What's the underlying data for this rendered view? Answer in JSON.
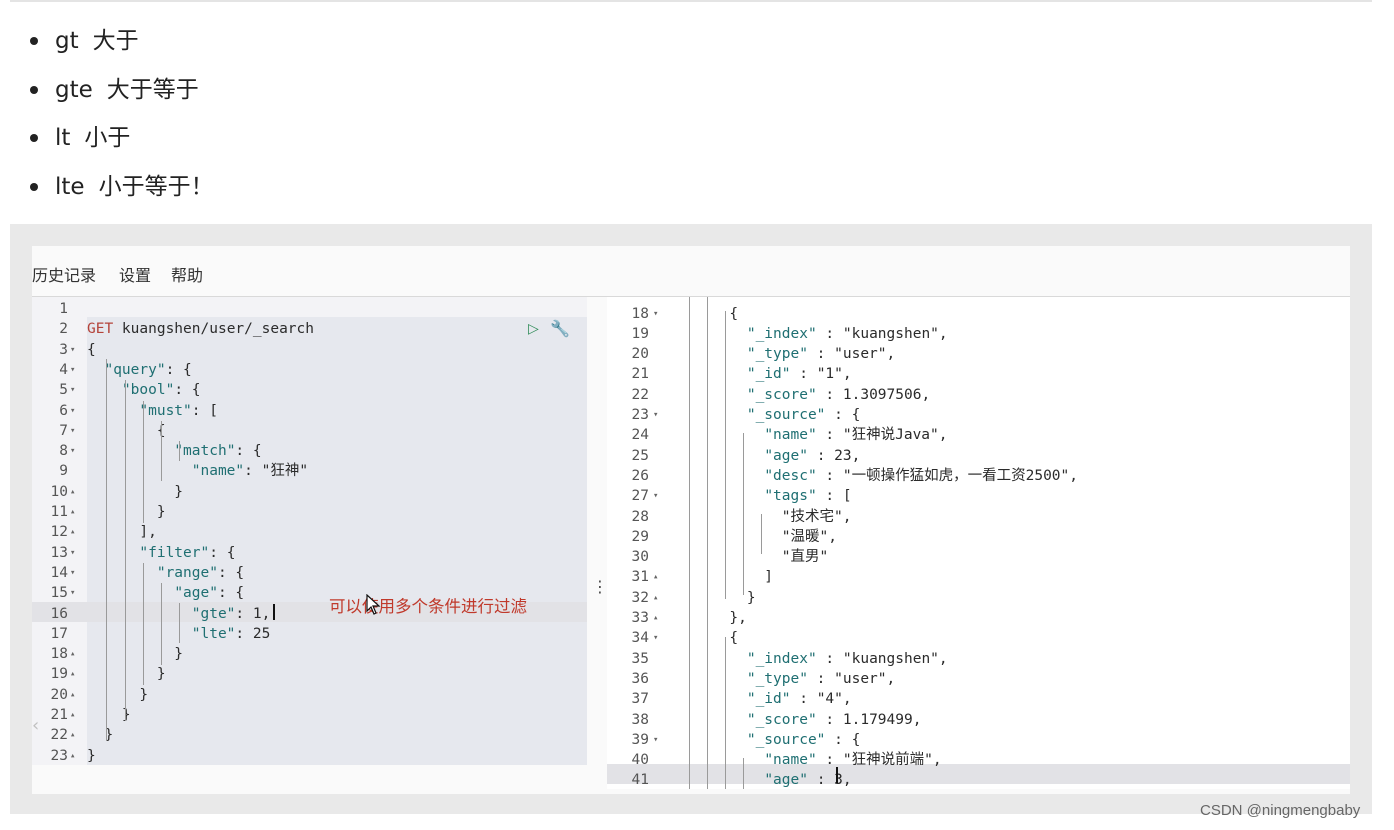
{
  "bullets": [
    {
      "op": "gt",
      "desc": "大于"
    },
    {
      "op": "gte",
      "desc": "大于等于"
    },
    {
      "op": "lt",
      "desc": "小于"
    },
    {
      "op": "lte",
      "desc": "小于等于！"
    }
  ],
  "menu": {
    "history": "历史记录",
    "settings": "设置",
    "help": "帮助"
  },
  "request_lines": [
    {
      "n": "1",
      "f": "",
      "t": ""
    },
    {
      "n": "2",
      "f": "",
      "t": "GET kuangshen/user/_search"
    },
    {
      "n": "3",
      "f": "▾",
      "t": "{"
    },
    {
      "n": "4",
      "f": "▾",
      "t": "  \"query\": {"
    },
    {
      "n": "5",
      "f": "▾",
      "t": "    \"bool\": {"
    },
    {
      "n": "6",
      "f": "▾",
      "t": "      \"must\": ["
    },
    {
      "n": "7",
      "f": "▾",
      "t": "        {"
    },
    {
      "n": "8",
      "f": "▾",
      "t": "          \"match\": {"
    },
    {
      "n": "9",
      "f": "",
      "t": "            \"name\": \"狂神\""
    },
    {
      "n": "10",
      "f": "▴",
      "t": "          }"
    },
    {
      "n": "11",
      "f": "▴",
      "t": "        }"
    },
    {
      "n": "12",
      "f": "▴",
      "t": "      ],"
    },
    {
      "n": "13",
      "f": "▾",
      "t": "      \"filter\": {"
    },
    {
      "n": "14",
      "f": "▾",
      "t": "        \"range\": {"
    },
    {
      "n": "15",
      "f": "▾",
      "t": "          \"age\": {"
    },
    {
      "n": "16",
      "f": "",
      "t": "            \"gte\": 1,"
    },
    {
      "n": "17",
      "f": "",
      "t": "            \"lte\": 25"
    },
    {
      "n": "18",
      "f": "▴",
      "t": "          }"
    },
    {
      "n": "19",
      "f": "▴",
      "t": "        }"
    },
    {
      "n": "20",
      "f": "▴",
      "t": "      }"
    },
    {
      "n": "21",
      "f": "▴",
      "t": "    }"
    },
    {
      "n": "22",
      "f": "▴",
      "t": "  }"
    },
    {
      "n": "23",
      "f": "▴",
      "t": "}"
    }
  ],
  "response_lines": [
    {
      "n": "18",
      "f": "▾",
      "t": "      {"
    },
    {
      "n": "19",
      "f": "",
      "t": "        \"_index\" : \"kuangshen\","
    },
    {
      "n": "20",
      "f": "",
      "t": "        \"_type\" : \"user\","
    },
    {
      "n": "21",
      "f": "",
      "t": "        \"_id\" : \"1\","
    },
    {
      "n": "22",
      "f": "",
      "t": "        \"_score\" : 1.3097506,"
    },
    {
      "n": "23",
      "f": "▾",
      "t": "        \"_source\" : {"
    },
    {
      "n": "24",
      "f": "",
      "t": "          \"name\" : \"狂神说Java\","
    },
    {
      "n": "25",
      "f": "",
      "t": "          \"age\" : 23,"
    },
    {
      "n": "26",
      "f": "",
      "t": "          \"desc\" : \"一顿操作猛如虎，一看工资2500\","
    },
    {
      "n": "27",
      "f": "▾",
      "t": "          \"tags\" : ["
    },
    {
      "n": "28",
      "f": "",
      "t": "            \"技术宅\","
    },
    {
      "n": "29",
      "f": "",
      "t": "            \"温暖\","
    },
    {
      "n": "30",
      "f": "",
      "t": "            \"直男\""
    },
    {
      "n": "31",
      "f": "▴",
      "t": "          ]"
    },
    {
      "n": "32",
      "f": "▴",
      "t": "        }"
    },
    {
      "n": "33",
      "f": "▴",
      "t": "      },"
    },
    {
      "n": "34",
      "f": "▾",
      "t": "      {"
    },
    {
      "n": "35",
      "f": "",
      "t": "        \"_index\" : \"kuangshen\","
    },
    {
      "n": "36",
      "f": "",
      "t": "        \"_type\" : \"user\","
    },
    {
      "n": "37",
      "f": "",
      "t": "        \"_id\" : \"4\","
    },
    {
      "n": "38",
      "f": "",
      "t": "        \"_score\" : 1.179499,"
    },
    {
      "n": "39",
      "f": "▾",
      "t": "        \"_source\" : {"
    },
    {
      "n": "40",
      "f": "",
      "t": "          \"name\" : \"狂神说前端\","
    },
    {
      "n": "41",
      "f": "",
      "t": "          \"age\" : 3,"
    }
  ],
  "annotation": "可以使用多个条件进行过滤",
  "watermark": "CSDN @ningmengbaby",
  "icons": {
    "run": "play-icon",
    "tools": "wrench-icon",
    "grip": "vertical-dots-icon"
  }
}
